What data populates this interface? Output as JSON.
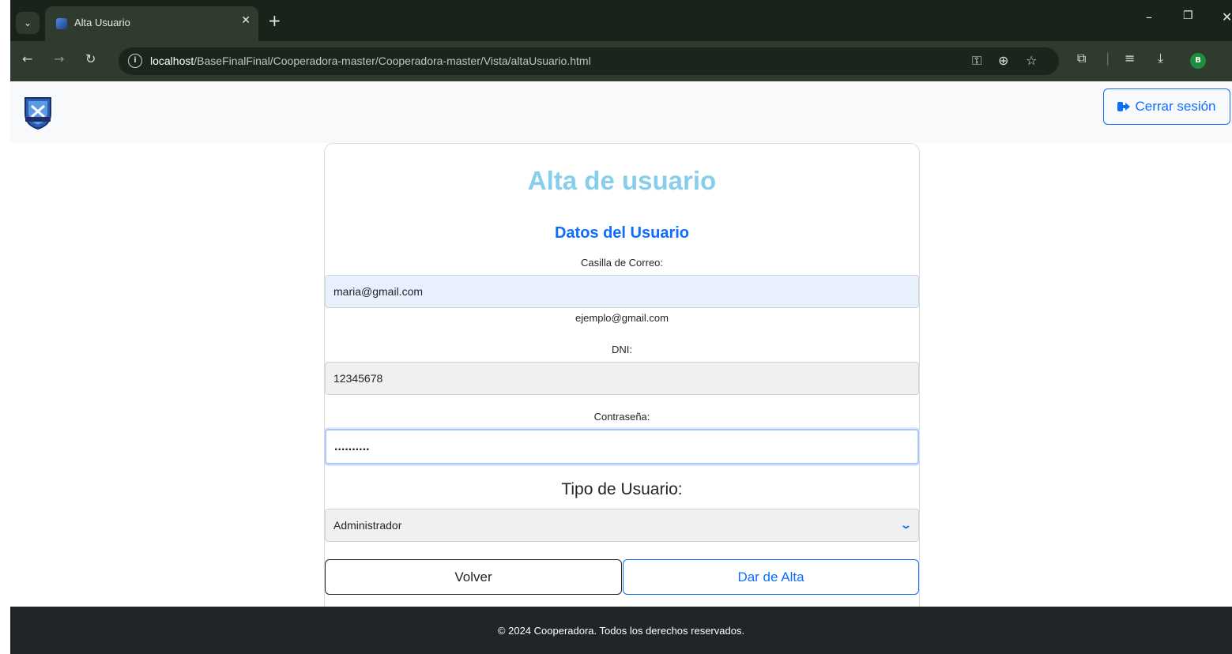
{
  "browser": {
    "tab_title": "Alta Usuario",
    "url_host": "localhost",
    "url_path": "/BaseFinalFinal/Cooperadora-master/Cooperadora-master/Vista/altaUsuario.html",
    "profile_initial": "B"
  },
  "header": {
    "logout_label": "Cerrar sesión"
  },
  "form": {
    "title": "Alta de usuario",
    "section_title": "Datos del Usuario",
    "email_label": "Casilla de Correo:",
    "email_value": "maria@gmail.com",
    "email_hint": "ejemplo@gmail.com",
    "dni_label": "DNI:",
    "dni_value": "12345678",
    "password_label": "Contraseña:",
    "password_value": "..........",
    "tipo_label": "Tipo de Usuario:",
    "tipo_value": "Administrador",
    "back_label": "Volver",
    "submit_label": "Dar de Alta"
  },
  "footer": {
    "text": "© 2024 Cooperadora. Todos los derechos reservados."
  },
  "colors": {
    "title": "#87ceeb",
    "primary": "#0d6efd",
    "footer_bg": "#212529"
  }
}
